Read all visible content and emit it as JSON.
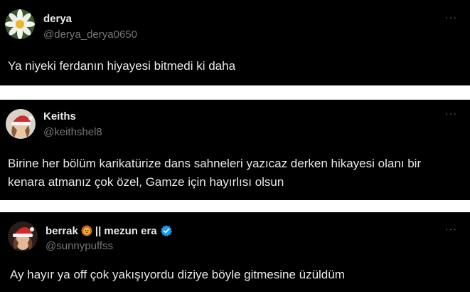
{
  "tweets": [
    {
      "name": "derya",
      "handle": "@derya_derya0650",
      "text": "Ya niyeki ferdanın hiyayesi bitmedi ki daha",
      "more_label": "···",
      "avatar_icon": "daisy-flower-avatar"
    },
    {
      "name": "Keiths",
      "handle": "@keithshel8",
      "text": "Birine her bölüm karikatürize dans sahneleri yazıcaz derken hikayesi olanı bir kenara atmanız çok özel, Gamze için hayırlısı olsun",
      "more_label": "···",
      "avatar_icon": "santa-hat-person-avatar"
    },
    {
      "name_part1": "berrak",
      "name_part2": "|| mezun era",
      "handle": "@sunnypuffss",
      "text": "Ay hayır ya off çok yakışıyordu diziye böyle gitmesine üzüldüm",
      "more_label": "···",
      "avatar_icon": "santa-hat-person-avatar",
      "emoji_icon": "lion-emoji",
      "verified_icon": "verified-badge-icon",
      "verified_color": "#1d9bf0"
    }
  ]
}
